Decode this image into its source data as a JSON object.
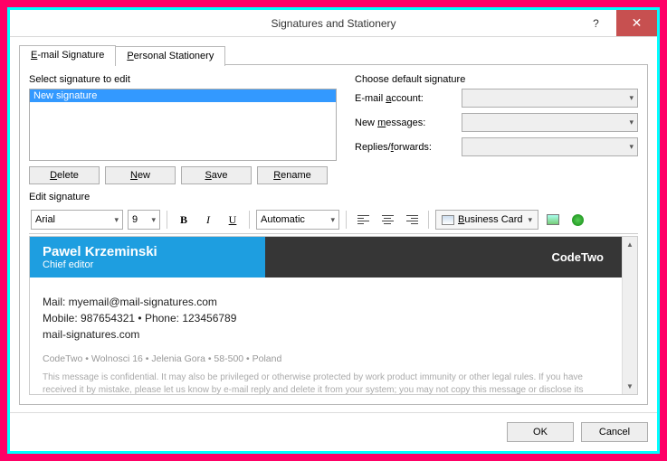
{
  "window": {
    "title": "Signatures and Stationery"
  },
  "tabs": {
    "email": "E-mail Signature",
    "stationery": "Personal Stationery"
  },
  "select_label": "Select signature to edit",
  "signatures": {
    "item0": "New signature"
  },
  "buttons": {
    "delete": "Delete",
    "new": "New",
    "save": "Save",
    "rename": "Rename",
    "ok": "OK",
    "cancel": "Cancel",
    "business_card": "Business Card"
  },
  "defaults": {
    "group_label": "Choose default signature",
    "account_label": "E-mail account:",
    "new_label": "New messages:",
    "reply_label": "Replies/forwards:",
    "account_value": "",
    "new_value": "",
    "reply_value": ""
  },
  "edit_label": "Edit signature",
  "toolbar": {
    "font": "Arial",
    "size": "9",
    "color": "Automatic",
    "b": "B",
    "i": "I",
    "u": "U"
  },
  "signature_preview": {
    "name": "Pawel Krzeminski",
    "role": "Chief editor",
    "brand": "CodeTwo",
    "mail": "Mail: myemail@mail-signatures.com",
    "phone": "Mobile: 987654321 • Phone: 123456789",
    "site": "mail-signatures.com",
    "address": "CodeTwo • Wolnosci 16 • Jelenia Gora • 58-500 • Poland",
    "legal": "This message is confidential. It may also be privileged or otherwise protected by work product immunity or other legal rules. If you have received it by mistake, please let us know by e-mail reply and delete it from your system; you may not copy this message or disclose its contents to anyone. Please send us by fax any message containing deadlines as"
  }
}
